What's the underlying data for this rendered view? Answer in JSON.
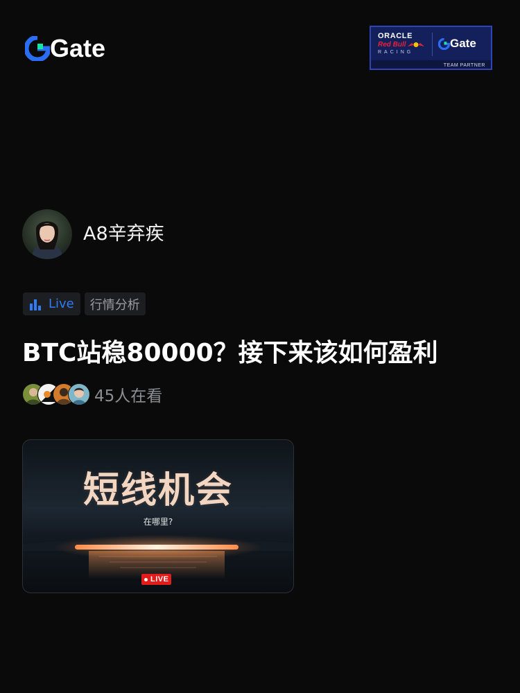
{
  "header": {
    "logo_text": "Gate",
    "logo_icon": "gate-logo-icon",
    "partner_badge": {
      "line1": "ORACLE",
      "line2": "Red Bull",
      "line3": "RACING",
      "gate_text": "Gate",
      "footer": "TEAM PARTNER"
    }
  },
  "host": {
    "name": "A8辛弃疾",
    "avatar_icon": "host-avatar"
  },
  "tags": {
    "live_label": "Live",
    "live_icon": "bar-chart-icon",
    "topic_label": "行情分析"
  },
  "title": "BTC站稳80000？接下来该如何盈利",
  "viewers": {
    "count_text": "45人在看",
    "avatar_count": 4
  },
  "video": {
    "headline": "短线机会",
    "subline": "在哪里?",
    "live_badge": "LIVE"
  },
  "colors": {
    "background": "#0a0a0b",
    "accent_blue": "#2f7cf6",
    "gate_green": "#17e6a1",
    "live_red": "#e21b1b",
    "muted_text": "#8c8e94"
  }
}
